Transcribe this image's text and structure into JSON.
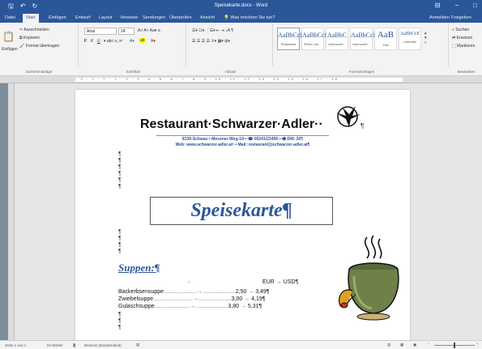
{
  "window": {
    "doc_title": "Speisekarte.docx - Word",
    "controls": [
      "⊟",
      "−",
      "□"
    ]
  },
  "menu": {
    "tabs": [
      "Datei",
      "Start",
      "Einfügen",
      "Entwurf",
      "Layout",
      "Verweise",
      "Sendungen",
      "Überprüfen",
      "Ansicht",
      "Was möchten Sie tun?"
    ],
    "right": [
      "Anmelden",
      "Freigeben"
    ]
  },
  "ribbon": {
    "clipboard": {
      "paste": "Einfügen",
      "cut": "Ausschneiden",
      "copy": "Kopieren",
      "format_painter": "Format übertragen",
      "label": "Zwischenablage"
    },
    "font": {
      "name": "Arial",
      "size": "24",
      "label": "Schriftart"
    },
    "paragraph": {
      "label": "Absatz"
    },
    "styles": {
      "items": [
        {
          "preview": "AaBbCcDc",
          "name": "¶Standard"
        },
        {
          "preview": "AaBbCcDc",
          "name": "¶Kein Lee..."
        },
        {
          "preview": "AaBbC",
          "name": "Überschrif..."
        },
        {
          "preview": "AaBbCcI",
          "name": "Überschrif..."
        },
        {
          "preview": "AaB",
          "name": "Titel"
        },
        {
          "preview": "AaBbCcE",
          "name": "Untertitel"
        }
      ],
      "label": "Formatvorlagen"
    },
    "editing": {
      "search": "Suchen",
      "replace": "Ersetzen",
      "select": "Markieren",
      "label": "Bearbeiten"
    }
  },
  "document": {
    "restaurant_name": "Restaurant·Schwarzer·Adler··",
    "address": "8130-Schwaz·•·Messner-Weg-14·•·☎·05241/23456·•·🖷·DW.·20¶",
    "web": "Web:·www.schwarzer-adler.at¹·•·Mail:·restaurant@schwarzer-adler.at¶",
    "heading": "Speisekarte¶",
    "section": "Suppen:¶",
    "currency_header": "EUR  →  USD¶",
    "para_mark": "¶",
    "items": [
      {
        "name": "Backerbsensuppe",
        "eur": "2,50",
        "usd": "3,49¶"
      },
      {
        "name": "Zwiebelsuppe",
        "eur": "3,00",
        "usd": "4,19¶"
      },
      {
        "name": "Gulaschsuppe",
        "eur": "3,80",
        "usd": "5,31¶"
      }
    ]
  },
  "status": {
    "page": "Seite 1 von 1",
    "words": "94 Wörter",
    "language": "Deutsch (Deutschland)"
  },
  "colors": {
    "accent": "#2b579a",
    "heading": "#2b579a"
  }
}
